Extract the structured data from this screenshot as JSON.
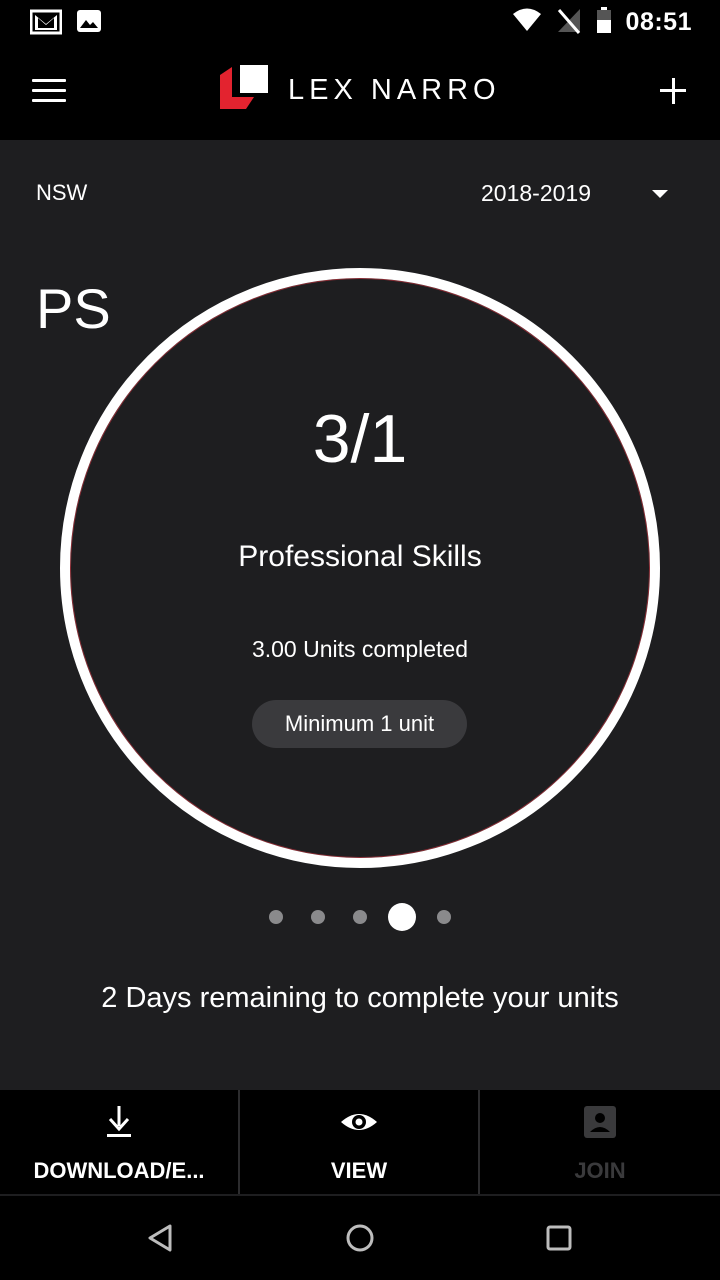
{
  "status_bar": {
    "time": "08:51",
    "icons": [
      "gmail-icon",
      "image-icon",
      "wifi-icon",
      "no-signal-icon",
      "battery-icon"
    ]
  },
  "app_bar": {
    "brand": "LEX NARRO",
    "menu_icon": "menu-icon",
    "add_icon": "plus-icon",
    "brand_color": "#e3232f"
  },
  "filters": {
    "region": "NSW",
    "year": "2018-2019"
  },
  "card": {
    "abbreviation": "PS",
    "ratio": "3/1",
    "category": "Professional Skills",
    "completed": "3.00 Units completed",
    "minimum": "Minimum 1 unit",
    "progress_fraction": 1.0
  },
  "pager": {
    "count": 5,
    "active_index": 3
  },
  "remaining_text": "2 Days remaining to complete your units",
  "actions": [
    {
      "label": "DOWNLOAD/E...",
      "icon": "download-icon",
      "enabled": true
    },
    {
      "label": "VIEW",
      "icon": "eye-icon",
      "enabled": true
    },
    {
      "label": "JOIN",
      "icon": "contact-card-icon",
      "enabled": false
    }
  ],
  "nav": [
    "back-icon",
    "home-icon",
    "recents-icon"
  ]
}
